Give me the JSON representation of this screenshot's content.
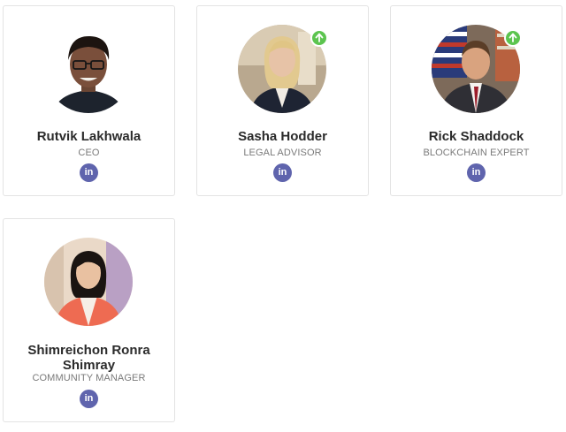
{
  "team": [
    {
      "name": "Rutvik Lakhwala",
      "role": "CEO",
      "linkedin_label": "in",
      "avatar_icon": "person-photo",
      "badge": false
    },
    {
      "name": "Sasha Hodder",
      "role": "LEGAL ADVISOR",
      "linkedin_label": "in",
      "avatar_icon": "person-photo",
      "badge": true
    },
    {
      "name": "Rick Shaddock",
      "role": "BLOCKCHAIN EXPERT",
      "linkedin_label": "in",
      "avatar_icon": "person-photo",
      "badge": true
    },
    {
      "name": "Shimreichon Ronra Shimray",
      "role": "COMMUNITY MANAGER",
      "linkedin_label": "in",
      "avatar_icon": "person-photo",
      "badge": false
    }
  ],
  "colors": {
    "linkedin": "#5f64ad",
    "badge": "#5cc44f",
    "border": "#e3e3e3",
    "name_text": "#2b2b2b",
    "role_text": "#7a7a7a"
  },
  "icons": {
    "linkedin": "linkedin-icon",
    "badge": "arrow-up-icon"
  }
}
